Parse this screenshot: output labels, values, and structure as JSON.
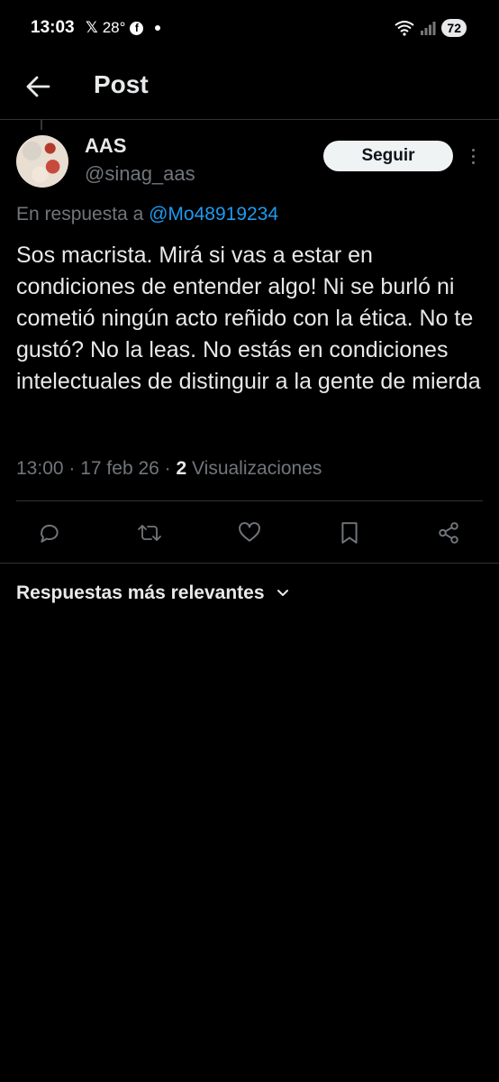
{
  "status_bar": {
    "time": "13:03",
    "x_icon": "𝕏",
    "temperature": "28°",
    "facebook_icon": "f",
    "battery": "72"
  },
  "header": {
    "title": "Post",
    "back_icon": "arrow-left-icon"
  },
  "post": {
    "author_name": "AAS",
    "author_handle": "@sinag_aas",
    "follow_label": "Seguir",
    "reply_prefix": "En respuesta a",
    "reply_to": "@Mo48919234",
    "text": "Sos macrista. Mirá si vas a estar en condiciones de entender algo! Ni se burló ni cometió ningún acto reñido con la ética. No te gustó? No la leas. No estás en condiciones intelectuales de distinguir a la gente de mierda",
    "time": "13:00",
    "date": "17 feb 26",
    "views_count": "2",
    "views_label": "Visualizaciones"
  },
  "actions": [
    "reply-icon",
    "repost-icon",
    "like-icon",
    "bookmark-icon",
    "share-icon"
  ],
  "sort": {
    "label": "Respuestas más relevantes"
  },
  "colors": {
    "background": "#000000",
    "text": "#e7e9ea",
    "secondary": "#71767b",
    "link": "#1d9bf0",
    "divider": "#2f3336"
  }
}
